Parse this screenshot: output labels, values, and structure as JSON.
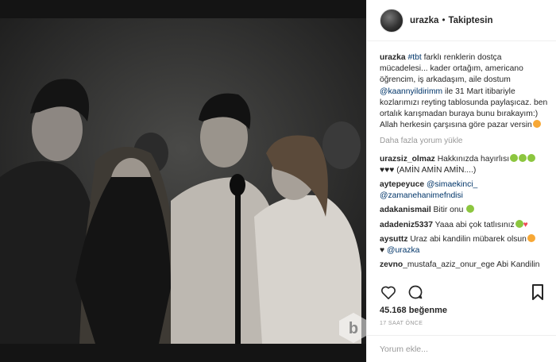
{
  "header": {
    "username": "urazka",
    "separator": "•",
    "follow_status": "Takiptesin"
  },
  "caption": {
    "username": "urazka",
    "hashtag": "#tbt",
    "text1": " farklı renklerin dostça mücadelesi... kader ortağım, americano öğrencim, iş arkadaşım, aile dostum ",
    "mention": "@kaannyildirimm",
    "text2": " ile 31 Mart itibariyle kozlarımızı reyting tablosunda paylaşıcaz. ben ortalık karışmadan buraya bunu bırakayım:) Allah herkesin çarşısına göre pazar versin"
  },
  "load_more": "Daha fazla yorum yükle",
  "comments": [
    {
      "user": "urazsiz_olmaz",
      "text": " Hakkınızda hayırlısı",
      "text_b": "♥♥♥ (AMİN AMİN AMİN....)"
    },
    {
      "user": "aytepeyuce",
      "mention1": "@simaekinci_",
      "mention2": "@zamanehanimefndisi"
    },
    {
      "user": "adakanismail",
      "text": " Bitir onu"
    },
    {
      "user": "adadeniz5337",
      "text": " Yaaa abi çok tatlısınız"
    },
    {
      "user": "aysuttz",
      "text": " Uraz abi kandilin mübarek olsun",
      "mention": "@urazka",
      "heart": "♥"
    },
    {
      "user": "zevno",
      "text": "_mustafa_aziz_onur_ege Abi Kandilin"
    }
  ],
  "actions": {
    "like_icon": "heart-icon",
    "comment_icon": "comment-icon",
    "save_icon": "bookmark-icon"
  },
  "likes": "45.168 beğenme",
  "time": "17 SAAT ÖNCE",
  "comment_input": {
    "placeholder": "Yorum ekle..."
  }
}
